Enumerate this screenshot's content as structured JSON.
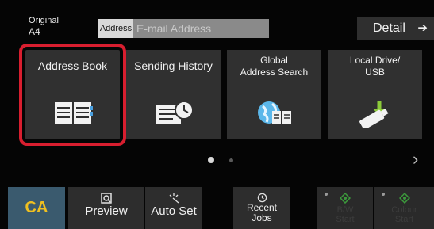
{
  "top": {
    "original_label": "Original",
    "original_value": "A4",
    "address_tag": "Address",
    "address_placeholder": "E-mail Address",
    "detail_label": "Detail"
  },
  "tiles": [
    {
      "label": "Address Book",
      "icon": "address-book-icon",
      "selected": true
    },
    {
      "label": "Sending History",
      "icon": "sending-history-icon"
    },
    {
      "label": "Global Address Search",
      "label_lines": [
        "Global",
        "Address Search"
      ],
      "icon": "global-address-search-icon"
    },
    {
      "label": "Local Drive/ USB",
      "label_lines": [
        "Local Drive/",
        "USB"
      ],
      "icon": "usb-drive-icon"
    }
  ],
  "bottom": {
    "ca": "CA",
    "preview": "Preview",
    "auto_set": "Auto Set",
    "recent_jobs": "Recent Jobs",
    "recent_jobs_lines": [
      "Recent",
      "Jobs"
    ],
    "bw_start_lines": [
      "B/W",
      "Start"
    ],
    "color_start_lines": [
      "Colour",
      "Start"
    ]
  },
  "colors": {
    "highlight": "#d81e2f",
    "ca_text": "#f0c020",
    "ca_bg": "#3a5a6e",
    "start_indicator": "#3c9a3c"
  }
}
